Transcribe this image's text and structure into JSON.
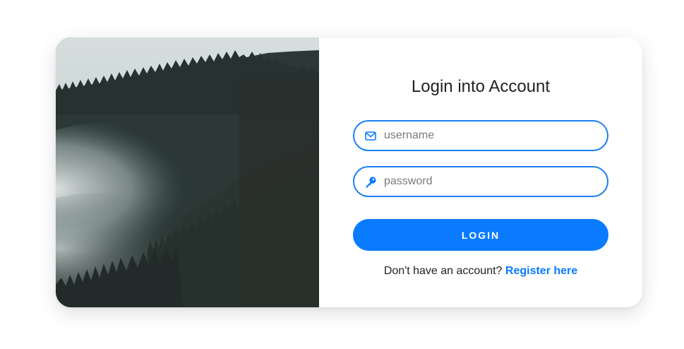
{
  "login_form": {
    "title": "Login into Account",
    "username": {
      "placeholder": "username",
      "value": "",
      "icon": "envelope-icon"
    },
    "password": {
      "placeholder": "password",
      "value": "",
      "icon": "key-icon"
    },
    "submit_label": "LOGIN",
    "register_prompt": "Don't have an account?",
    "register_link": "Register here"
  },
  "colors": {
    "accent": "#0a7bff",
    "photo_forest": "#26302d",
    "photo_sky": "#cfd8d8"
  }
}
